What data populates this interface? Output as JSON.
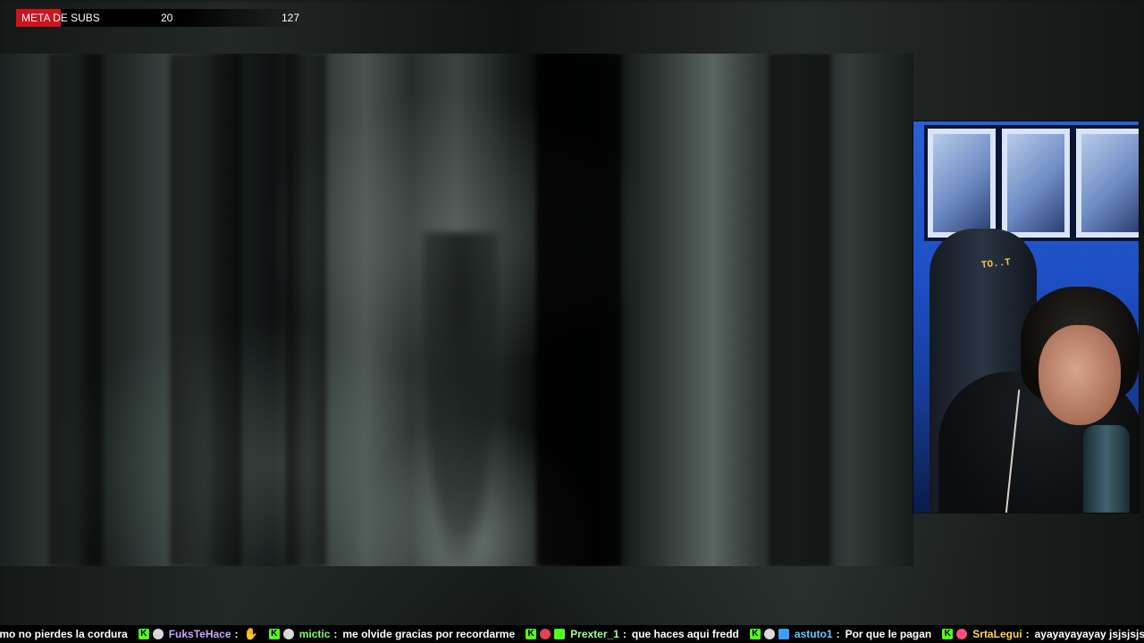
{
  "sub_goal": {
    "label": "META DE SUBS",
    "current": "20",
    "target": "127",
    "progress_fraction": 0.157,
    "fill_color": "#d0131b"
  },
  "video": {
    "description_icon": "forest-scene"
  },
  "webcam": {
    "chair_text": "TO..T"
  },
  "chat": {
    "messages": [
      {
        "user": "",
        "user_color": "#ffffff",
        "text": "omo no pierdes la cordura",
        "badges": []
      },
      {
        "user": "FuksTeHace",
        "user_color": "#c9a7ff",
        "text": "",
        "emote": "hand-emote",
        "badges": [
          "kick-badge",
          "moon-badge"
        ]
      },
      {
        "user": "mictic",
        "user_color": "#7cff6b",
        "text": "me olvide gracias por recordarme",
        "badges": [
          "kick-badge",
          "moon-badge"
        ]
      },
      {
        "user": "Prexter_1",
        "user_color": "#a3ff8a",
        "text": "que haces aqui fredd",
        "badges": [
          "kick-badge",
          "lantern-badge",
          "star-badge"
        ]
      },
      {
        "user": "astuto1",
        "user_color": "#69c9ff",
        "text": "Por que le pagan",
        "badges": [
          "kick-badge",
          "moon-badge",
          "vip-badge"
        ]
      },
      {
        "user": "SrtaLegui",
        "user_color": "#ffd84a",
        "text": "ayayayayayay  jsjsjsjs",
        "badges": [
          "kick-badge",
          "rose-badge"
        ]
      }
    ]
  },
  "colors": {
    "kick_green": "#53fc18",
    "ticker_bg": "#000000"
  }
}
